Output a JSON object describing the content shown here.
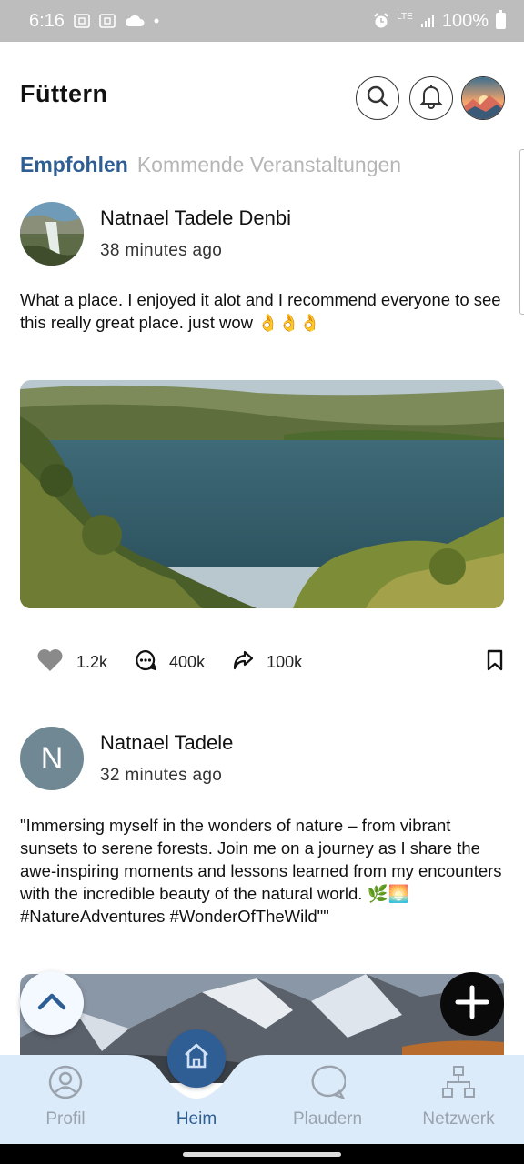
{
  "status_bar": {
    "time": "6:16",
    "network": "LTE",
    "battery": "100%"
  },
  "header": {
    "title": "Füttern"
  },
  "tabs": [
    {
      "label": "Empfohlen",
      "active": true
    },
    {
      "label": "Kommende Veranstaltungen",
      "active": false
    }
  ],
  "posts": [
    {
      "author": "Natnael Tadele Denbi",
      "time": "38 minutes ago",
      "text": "What a place. I enjoyed it alot and I recommend everyone to see this really great place. just wow 👌👌👌",
      "image": "lake-landscape",
      "likes": "1.2k",
      "comments": "400k",
      "shares": "100k"
    },
    {
      "author": "Natnael Tadele",
      "avatar_initial": "N",
      "time": "32 minutes ago",
      "text": "\"Immersing myself in the wonders of nature – from vibrant sunsets to serene forests. Join me on a journey as I share the awe-inspiring moments and lessons learned from my encounters with the incredible beauty of the natural world. 🌿🌅 #NatureAdventures #WonderOfTheWild\"\"",
      "image": "snowy-mountains"
    }
  ],
  "bottom_nav": [
    {
      "label": "Profil",
      "icon": "profile-icon",
      "active": false
    },
    {
      "label": "Heim",
      "icon": "home-icon",
      "active": true
    },
    {
      "label": "Plaudern",
      "icon": "chat-icon",
      "active": false
    },
    {
      "label": "Netzwerk",
      "icon": "network-icon",
      "active": false
    }
  ],
  "colors": {
    "accent": "#2f5e94",
    "nav_background": "#dcebf9",
    "inactive_tab": "#b6b6b6"
  }
}
